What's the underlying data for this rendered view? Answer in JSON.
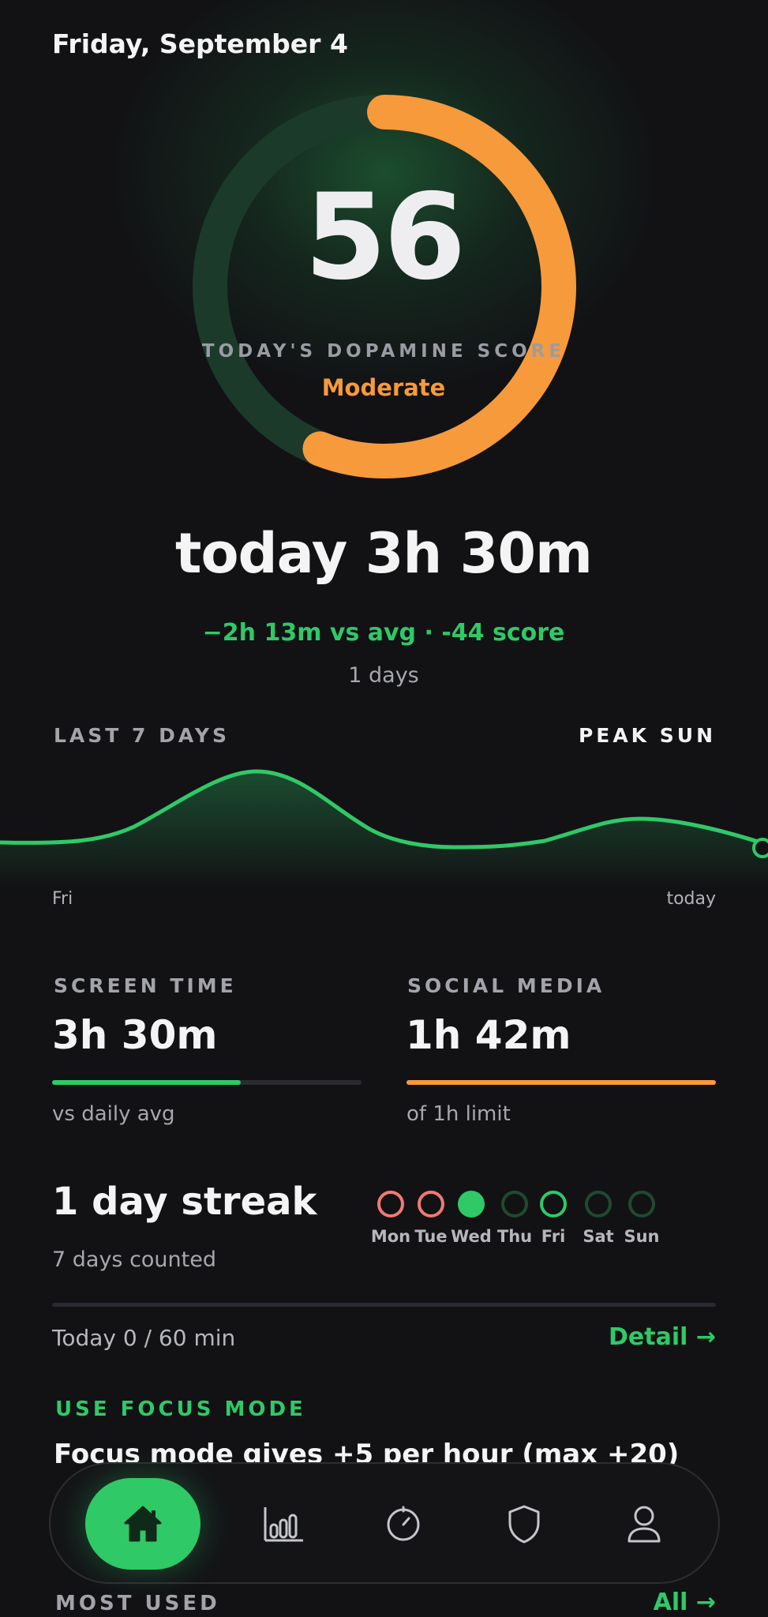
{
  "header": {
    "date": "Friday, September 4"
  },
  "score": {
    "value": "56",
    "label": "TODAY'S DOPAMINE SCORE",
    "level": "Moderate",
    "fraction": 0.56,
    "ring_color": "#f79a3b",
    "track_color": "#1c3a2a"
  },
  "summary": {
    "today": "today 3h 30m",
    "delta": "−2h 13m vs avg · -44 score",
    "days": "1 days"
  },
  "trend": {
    "label": "LAST 7 DAYS",
    "peak": "PEAK SUN",
    "start_label": "Fri",
    "end_label": "today",
    "line_color": "#2fc967"
  },
  "stats": {
    "screen_time": {
      "label": "SCREEN TIME",
      "value": "3h 30m",
      "sub": "vs daily avg",
      "progress": 0.61,
      "color": "#2fc967"
    },
    "social_media": {
      "label": "SOCIAL MEDIA",
      "value": "1h 42m",
      "sub": "of 1h limit",
      "progress": 1.0,
      "color": "#f79a3b"
    }
  },
  "streak": {
    "title": "1 day streak",
    "sub": "7 days counted",
    "days": [
      {
        "label": "Mon",
        "state": "missed"
      },
      {
        "label": "Tue",
        "state": "missed"
      },
      {
        "label": "Wed",
        "state": "done"
      },
      {
        "label": "Thu",
        "state": "empty"
      },
      {
        "label": "Fri",
        "state": "today"
      },
      {
        "label": "Sat",
        "state": "empty"
      },
      {
        "label": "Sun",
        "state": "empty"
      }
    ]
  },
  "goal": {
    "text": "Today 0 / 60 min",
    "detail": "Detail →"
  },
  "focus": {
    "label": "USE FOCUS MODE",
    "text": "Focus mode gives +5 per hour (max +20)"
  },
  "most_used": {
    "label": "MOST USED",
    "all": "All →"
  },
  "nav": {
    "items": [
      "home-icon",
      "stats-icon",
      "timer-icon",
      "shield-icon",
      "profile-icon"
    ],
    "active": "home-icon"
  }
}
